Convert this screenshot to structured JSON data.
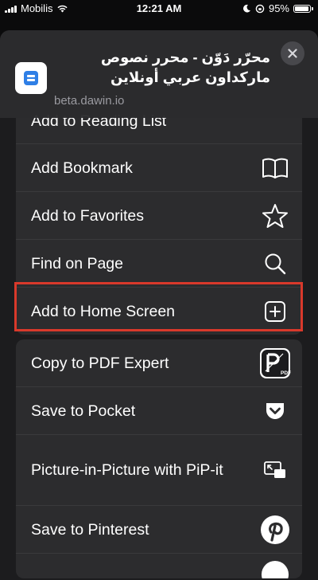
{
  "status_bar": {
    "carrier": "Mobilis",
    "time": "12:21 AM",
    "battery": "95%"
  },
  "header": {
    "title": "محرّر دَوّن - محرر نصوص ماركداون عربي أونلاين",
    "url": "beta.dawin.io"
  },
  "actions_group_1": [
    {
      "label": "Add to Reading List",
      "icon": "glasses-icon"
    },
    {
      "label": "Add Bookmark",
      "icon": "book-icon"
    },
    {
      "label": "Add to Favorites",
      "icon": "star-icon"
    },
    {
      "label": "Find on Page",
      "icon": "search-icon"
    },
    {
      "label": "Add to Home Screen",
      "icon": "plus-square-icon"
    }
  ],
  "actions_group_2": [
    {
      "label": "Copy to PDF Expert",
      "icon": "pdf-expert-icon"
    },
    {
      "label": "Save to Pocket",
      "icon": "pocket-icon"
    },
    {
      "label": "Picture-in-Picture with PiP-it",
      "icon": "pip-icon"
    },
    {
      "label": "Save to Pinterest",
      "icon": "pinterest-icon"
    }
  ],
  "colors": {
    "highlight": "#d9392b",
    "sheet": "#1c1c1e",
    "card": "#2c2c2e"
  }
}
